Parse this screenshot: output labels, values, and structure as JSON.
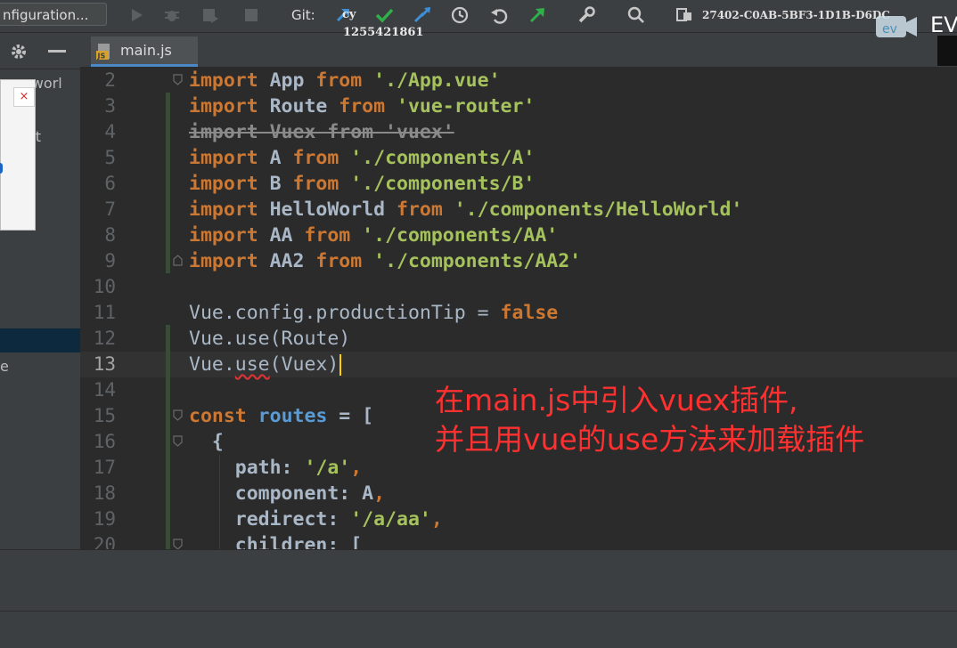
{
  "toolbar": {
    "run_config": "nfiguration...",
    "git_label": "Git:",
    "overlay_user": "cy",
    "overlay_number": "1255421861",
    "device_id": "27402-C0AB-5BF3-1D1B-D6DC",
    "ev_text": "EV",
    "icons": [
      "run-icon",
      "debug-icon",
      "coverage-icon",
      "stop-icon",
      "vcs-update-icon",
      "vcs-commit-icon",
      "vcs-merge-icon",
      "history-icon",
      "revert-icon",
      "push-icon",
      "wrench-icon",
      "search-icon",
      "device-icon"
    ]
  },
  "left_panel": {
    "tree_fragment_1": "-worl",
    "tree_fragment_2": "ot",
    "tree_fragment_3": "e",
    "popup_close": "×"
  },
  "tab": {
    "label": "main.js",
    "icon_text": "JS"
  },
  "editor": {
    "lines": [
      {
        "n": "2",
        "current": false
      },
      {
        "n": "3",
        "current": false
      },
      {
        "n": "4",
        "current": false
      },
      {
        "n": "5",
        "current": false
      },
      {
        "n": "6",
        "current": false
      },
      {
        "n": "7",
        "current": false
      },
      {
        "n": "8",
        "current": false
      },
      {
        "n": "9",
        "current": false
      },
      {
        "n": "10",
        "current": false
      },
      {
        "n": "11",
        "current": false
      },
      {
        "n": "12",
        "current": false
      },
      {
        "n": "13",
        "current": true
      },
      {
        "n": "14",
        "current": false
      },
      {
        "n": "15",
        "current": false
      },
      {
        "n": "16",
        "current": false
      },
      {
        "n": "17",
        "current": false
      },
      {
        "n": "18",
        "current": false
      },
      {
        "n": "19",
        "current": false
      },
      {
        "n": "20",
        "current": false
      }
    ],
    "code": {
      "l2": {
        "kw": "import",
        "id": " App ",
        "from": "from",
        "str": " './App.vue'"
      },
      "l3": {
        "kw": "import",
        "id": " Route ",
        "from": "from",
        "str": " 'vue-router'"
      },
      "l4": {
        "text": "import Vuex from 'vuex'"
      },
      "l5": {
        "kw": "import",
        "id": " A ",
        "from": "from",
        "str": " './components/A'"
      },
      "l6": {
        "kw": "import",
        "id": " B ",
        "from": "from",
        "str": " './components/B'"
      },
      "l7": {
        "kw": "import",
        "id": " HelloWorld ",
        "from": "from",
        "str": " './components/HelloWorld'"
      },
      "l8": {
        "kw": "import",
        "id": " AA ",
        "from": "from",
        "str": " './components/AA'"
      },
      "l9": {
        "kw": "import",
        "id": " AA2 ",
        "from": "from",
        "str": " './components/AA2'"
      },
      "l11": {
        "obj": "Vue.config.productionTip",
        "op": " = ",
        "val": "false"
      },
      "l12": {
        "obj": "Vue.use(Route)"
      },
      "l13": {
        "a": "Vue.",
        "b": "use",
        "c": "(Vuex)"
      },
      "l15": {
        "kw": "const",
        "var": " routes",
        "rest": " = ["
      },
      "l16": {
        "text": "  {"
      },
      "l17": {
        "key": "    path:",
        "str": " '/a'",
        "punc": ","
      },
      "l18": {
        "key": "    component:",
        "id": " A",
        "punc": ","
      },
      "l19": {
        "key": "    redirect:",
        "str": " '/a/aa'",
        "punc": ","
      },
      "l20": {
        "key": "    children:",
        "rest": " ["
      }
    }
  },
  "annotation": {
    "line1": "在main.js中引入vuex插件,",
    "line2": "并且用vue的use方法来加载插件"
  },
  "colors": {
    "keyword": "#cc7832",
    "string": "#a5c25c",
    "annotation": "#ff3030",
    "number_var": "#5a9bd5"
  }
}
